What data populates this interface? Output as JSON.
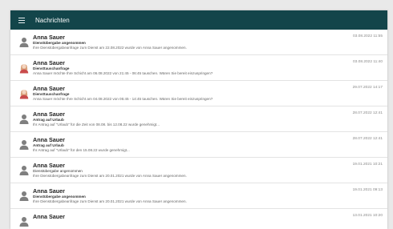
{
  "header": {
    "title": "Nachrichten"
  },
  "messages": [
    {
      "name": "Anna Sauer",
      "subject": "Dienstübergabe angenommen",
      "body": "Ihre Dienstübergabeanfrage zum Dienst am 22.08.2022 wurde von Anna Sauer angenommen.",
      "date": "03.08.2022 11:55",
      "avatar": "person-icon"
    },
    {
      "name": "Anna Sauer",
      "subject": "Diensttauschanfrage",
      "body": "Anna Sauer möchte Ihre Schicht am 06.08.2022 von 21:45 - 06:45 tauschen. Wären Sie bereit einzuspringen?",
      "date": "03.08.2022 11:40",
      "avatar": "female-avatar"
    },
    {
      "name": "Anna Sauer",
      "subject": "Diensttauschanfrage",
      "body": "Anna Sauer möchte Ihre Schicht am 04.08.2022 von 05:45 - 14:45 tauschen. Wären Sie bereit einzuspringen?",
      "date": "29.07.2022 14:17",
      "avatar": "female-avatar"
    },
    {
      "name": "Anna Sauer",
      "subject": "Antrag auf Urlaub",
      "body": "Ihr Antrag auf \"Urlaub\" für die Zeit von 08.08. bis 12.08.22 wurde genehmigt...",
      "date": "28.07.2022 12:41",
      "avatar": "person-icon"
    },
    {
      "name": "Anna Sauer",
      "subject": "Antrag auf Urlaub",
      "body": "Ihr Antrag auf \"Urlaub\" für den 15.08.22 wurde genehmigt...",
      "date": "28.07.2022 12:41",
      "avatar": "person-icon"
    },
    {
      "name": "Anna Sauer",
      "subject": "Dienstübergabe angenommen",
      "body": "Ihre Dienstübergabeanfrage zum Dienst am 20.01.2021 wurde von Anna Sauer angenommen.",
      "date": "19.01.2021 10:21",
      "avatar": "person-icon",
      "plain_subject": true
    },
    {
      "name": "Anna Sauer",
      "subject": "Dienstübergabe angenommen",
      "body": "Ihre Dienstübergabeanfrage zum Dienst am 20.01.2021 wurde von Anna Sauer angenommen.",
      "date": "19.01.2021 09:13",
      "avatar": "person-icon"
    },
    {
      "name": "Anna Sauer",
      "subject": "",
      "body": "",
      "date": "13.01.2021 10:20",
      "avatar": "person-icon"
    }
  ]
}
